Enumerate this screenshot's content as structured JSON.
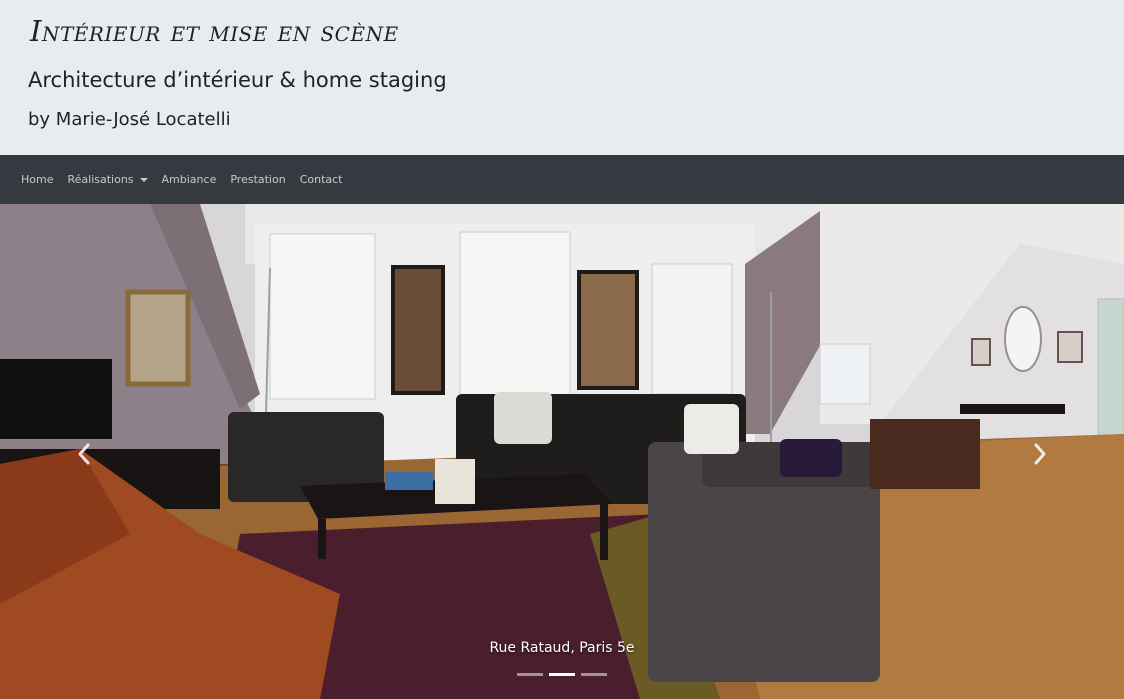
{
  "header": {
    "title": "Intérieur et mise en scène",
    "subtitle": "Architecture d’intérieur & home staging",
    "byline": "by Marie-José Locatelli"
  },
  "nav": {
    "items": [
      {
        "label": "Home"
      },
      {
        "label": "Réalisations"
      },
      {
        "label": "Ambiance"
      },
      {
        "label": "Prestation"
      },
      {
        "label": "Contact"
      }
    ]
  },
  "carousel": {
    "caption": "Rue Rataud, Paris 5e",
    "slide_count": 3,
    "active_index": 1,
    "prev_icon": "chevron-left-icon",
    "next_icon": "chevron-right-icon"
  },
  "colors": {
    "header_bg": "#e9ecef",
    "navbar_bg": "#343a40",
    "nav_text": "#c8cacc"
  }
}
